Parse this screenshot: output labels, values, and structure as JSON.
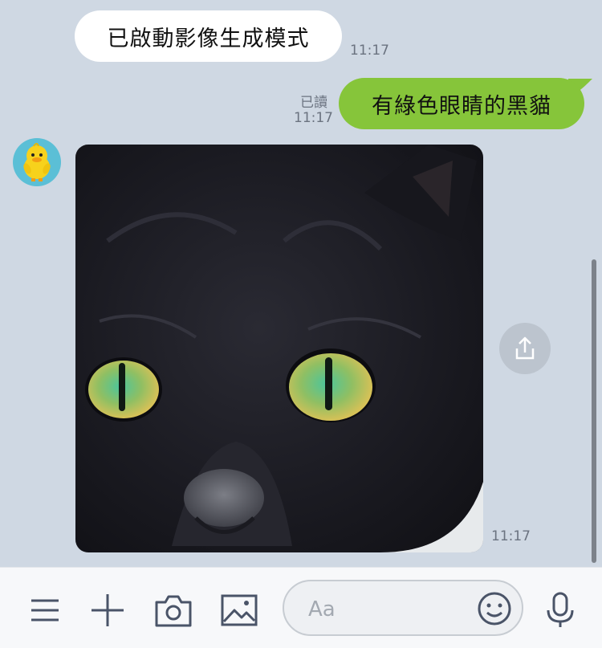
{
  "messages": {
    "incoming_text": "已啟動影像生成模式",
    "incoming_time": "11:17",
    "outgoing_text": "有綠色眼睛的黑貓",
    "outgoing_read": "已讀",
    "outgoing_time": "11:17",
    "image_time": "11:17"
  },
  "input": {
    "placeholder": "Aa"
  },
  "icons": {
    "menu": "menu-icon",
    "add": "plus-icon",
    "camera": "camera-icon",
    "gallery": "image-icon",
    "emoji": "emoji-icon",
    "mic": "microphone-icon",
    "share": "share-icon",
    "avatar": "duck-avatar-icon"
  },
  "colors": {
    "chat_background": "#cfd8e3",
    "outgoing_bubble": "#86c53a",
    "incoming_bubble": "#ffffff"
  }
}
